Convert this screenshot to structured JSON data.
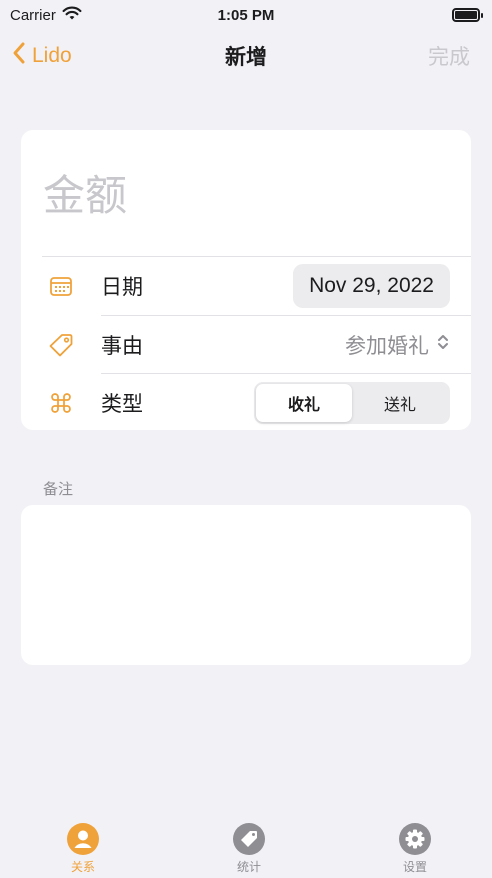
{
  "status_bar": {
    "carrier": "Carrier",
    "time": "1:05 PM"
  },
  "nav": {
    "back_label": "Lido",
    "title": "新增",
    "done_label": "完成"
  },
  "form": {
    "amount_placeholder": "金额",
    "date": {
      "label": "日期",
      "value": "Nov 29, 2022",
      "icon": "calendar-icon"
    },
    "reason": {
      "label": "事由",
      "value": "参加婚礼",
      "icon": "tag-icon"
    },
    "type": {
      "label": "类型",
      "options": [
        "收礼",
        "送礼"
      ],
      "selected": "收礼",
      "icon": "command-icon"
    }
  },
  "notes": {
    "header": "备注",
    "value": ""
  },
  "tabs": [
    {
      "label": "关系",
      "icon": "person-icon",
      "active": true
    },
    {
      "label": "统计",
      "icon": "tag-icon",
      "active": false
    },
    {
      "label": "设置",
      "icon": "gear-icon",
      "active": false
    }
  ],
  "colors": {
    "accent": "#f0a23a",
    "background": "#f2f1f6",
    "tab_inactive": "#8e8e93"
  }
}
